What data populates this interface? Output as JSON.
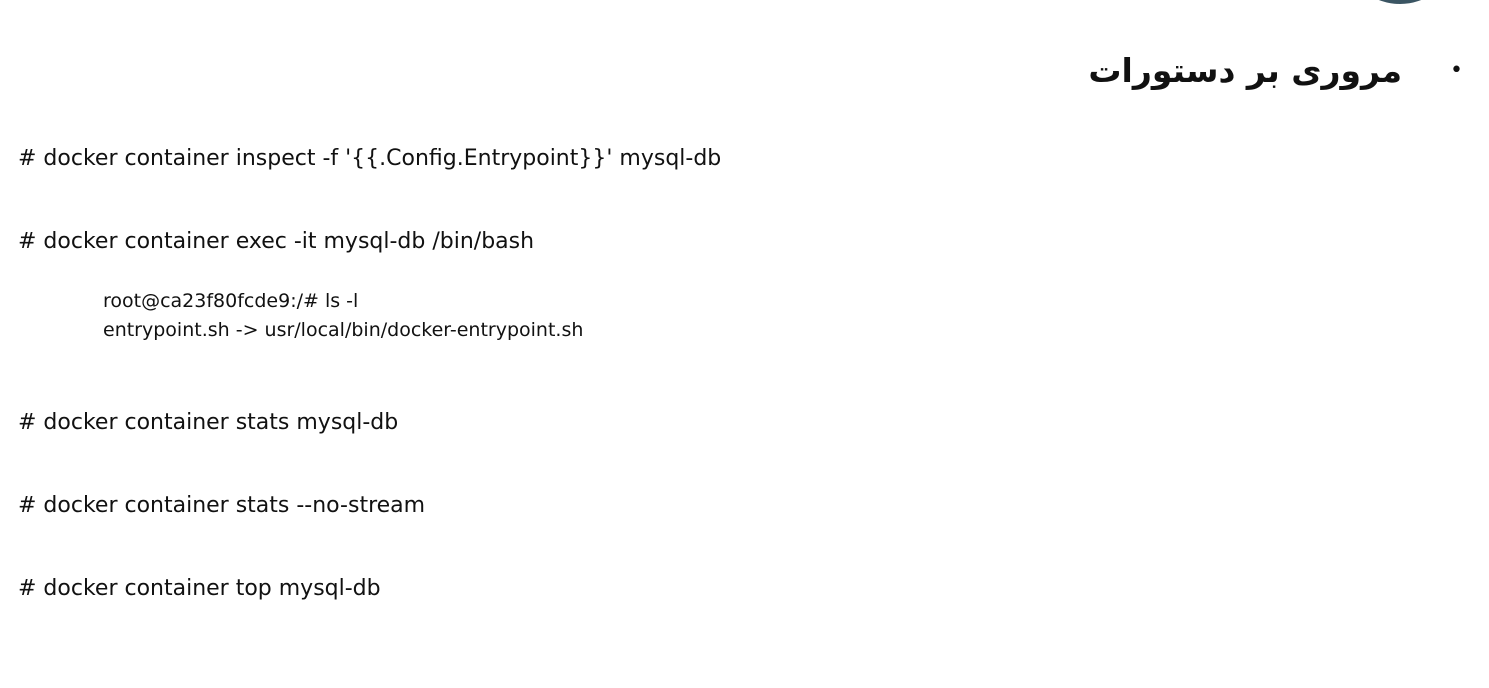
{
  "slide": {
    "title": "مروری بر دستورات",
    "bullet": "•"
  },
  "commands": [
    "# docker container inspect -f '{{.Config.Entrypoint}}' mysql-db",
    "# docker container exec -it mysql-db /bin/bash",
    "# docker container stats mysql-db",
    "# docker container stats --no-stream",
    "# docker container top mysql-db"
  ],
  "output": [
    "root@ca23f80fcde9:/# ls -l",
    "entrypoint.sh -> usr/local/bin/docker-entrypoint.sh"
  ]
}
